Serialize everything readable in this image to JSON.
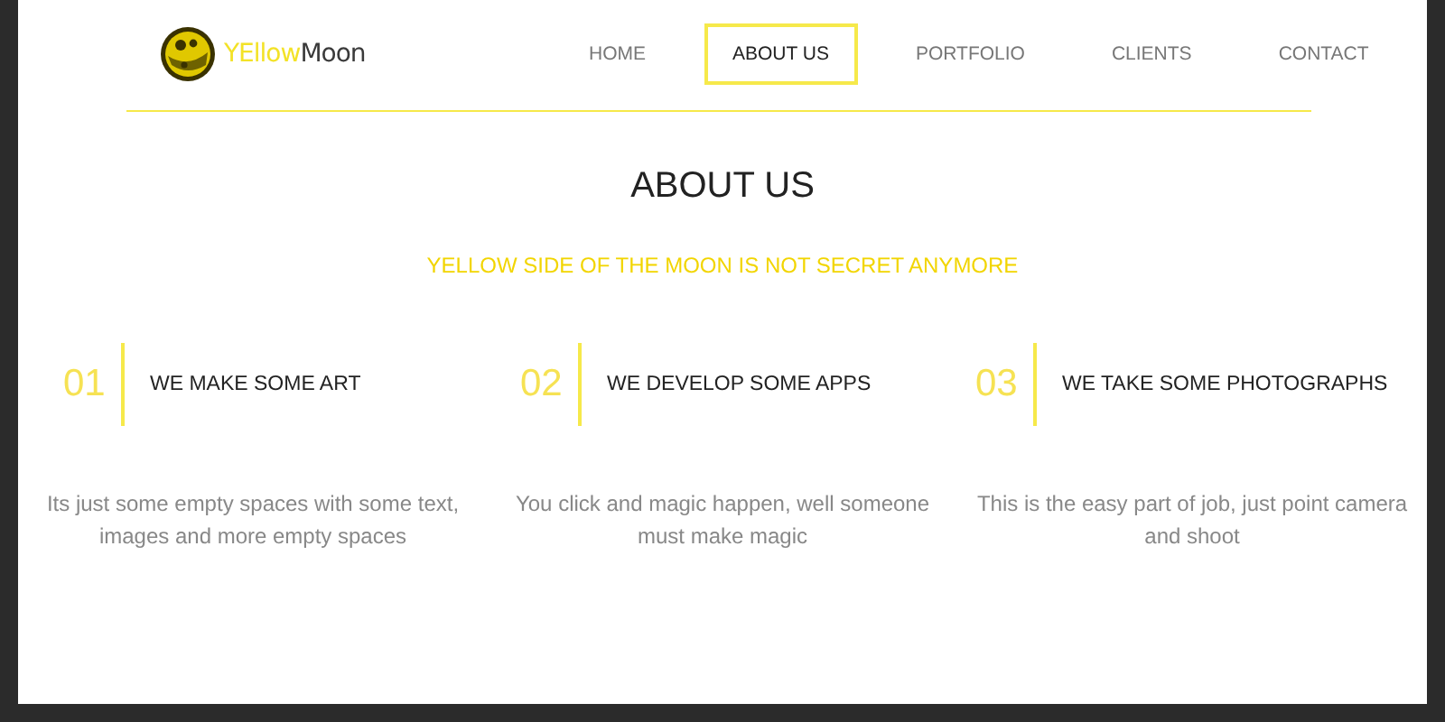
{
  "logo": {
    "text_yellow": "YEllow",
    "text_dark": "Moon"
  },
  "nav": [
    {
      "label": "HOME",
      "selected": false
    },
    {
      "label": "ABOUT US",
      "selected": true
    },
    {
      "label": "PORTFOLIO",
      "selected": false
    },
    {
      "label": "CLIENTS",
      "selected": false
    },
    {
      "label": "CONTACT",
      "selected": false
    }
  ],
  "title": "ABOUT US",
  "subtitle": "YELLOW SIDE OF THE MOON IS NOT SECRET ANYMORE",
  "features": [
    {
      "number": "01",
      "heading": "WE MAKE SOME ART",
      "text": "Its just some empty spaces with some text, images and more empty spaces"
    },
    {
      "number": "02",
      "heading": "WE DEVELOP SOME APPS",
      "text": "You click and magic happen, well someone must make magic"
    },
    {
      "number": "03",
      "heading": "WE TAKE SOME PHOTOGRAPHS",
      "text": "This is the easy part of job, just point camera and shoot"
    }
  ]
}
